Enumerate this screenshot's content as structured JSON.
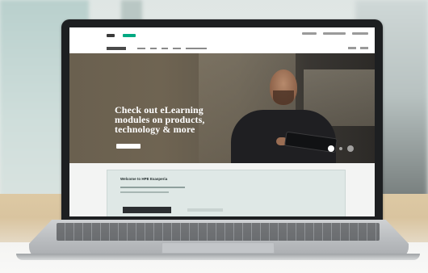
{
  "screen": {
    "hero": {
      "headline_lines": [
        "Check out eLearning",
        "modules on products,",
        "technology & more"
      ]
    },
    "welcome": {
      "title": "Welcome to HPE Exasperia"
    }
  }
}
